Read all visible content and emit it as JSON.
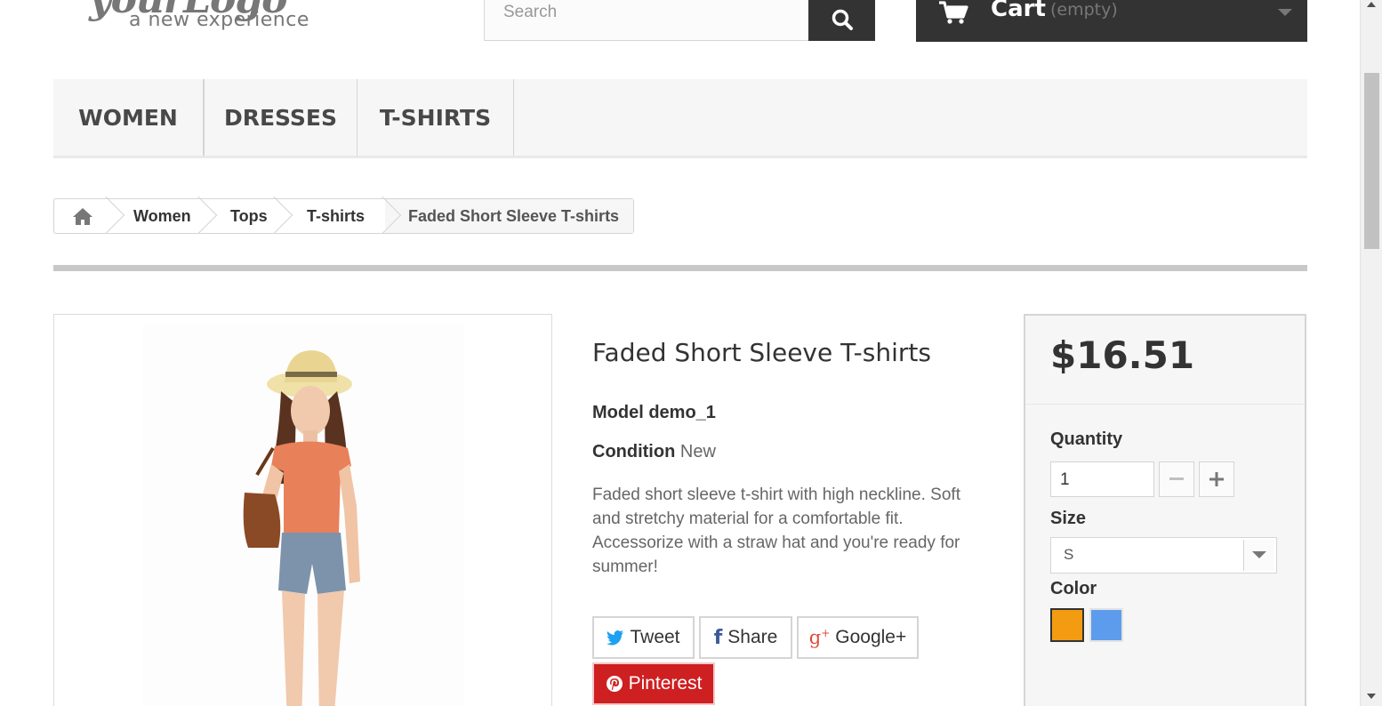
{
  "header": {
    "logo_script": "yourLogo",
    "logo_tagline": "a new experience",
    "search_placeholder": "Search",
    "cart_label": "Cart",
    "cart_status": "(empty)"
  },
  "menu": {
    "items": [
      {
        "label": "WOMEN"
      },
      {
        "label": "DRESSES"
      },
      {
        "label": "T-SHIRTS"
      }
    ]
  },
  "breadcrumb": {
    "items": [
      "Women",
      "Tops",
      "T-shirts"
    ],
    "current": "Faded Short Sleeve T-shirts"
  },
  "product": {
    "title": "Faded Short Sleeve T-shirts",
    "model_label": "Model",
    "model_value": "demo_1",
    "condition_label": "Condition",
    "condition_value": "New",
    "description": "Faded short sleeve t-shirt with high neckline. Soft and stretchy material for a comfortable fit. Accessorize with a straw hat and you're ready for summer!"
  },
  "social": {
    "tweet": "Tweet",
    "share": "Share",
    "google": "Google+",
    "pinterest": "Pinterest"
  },
  "buy": {
    "price": "$16.51",
    "quantity_label": "Quantity",
    "quantity_value": "1",
    "size_label": "Size",
    "size_value": "S",
    "color_label": "Color",
    "colors": [
      "#f39c11",
      "#5d9cec"
    ]
  },
  "colors": {
    "dark": "#333333",
    "pinterest": "#ce1f21",
    "twitter": "#1da1f2",
    "facebook": "#3b5998",
    "google": "#dd4b39"
  }
}
